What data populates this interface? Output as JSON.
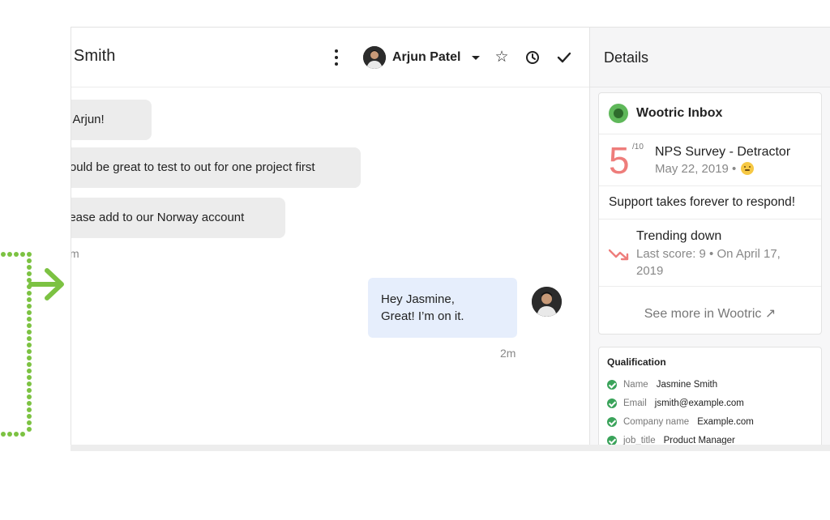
{
  "conversation": {
    "contact_name": "e Smith",
    "assignee": {
      "name": "Arjun Patel"
    },
    "icons": {
      "more": "more-vertical-icon",
      "star": "star-icon",
      "snooze": "clock-icon",
      "close": "check-icon"
    },
    "incoming_messages": [
      {
        "text": "Hi Arjun!"
      },
      {
        "text": "Would be great to test to out for one project first"
      },
      {
        "text": "Please add to our Norway account"
      }
    ],
    "incoming_time": "m",
    "outgoing_message": {
      "line1": "Hey Jasmine,",
      "line2": "Great! I’m on it.",
      "time": "2m"
    }
  },
  "details": {
    "title": "Details",
    "wootric": {
      "title": "Wootric Inbox",
      "score": "5",
      "score_max": "/10",
      "survey_name": "NPS Survey - Detractor",
      "survey_date": "May 22, 2019 •",
      "comment": "Support takes forever to respond!",
      "trend_title": "Trending down",
      "trend_detail": "Last score: 9 • On April 17, 2019",
      "see_more": "See more in Wootric ↗"
    },
    "qualification": {
      "title": "Qualification",
      "fields": [
        {
          "key": "Name",
          "value": "Jasmine Smith"
        },
        {
          "key": "Email",
          "value": "jsmith@example.com"
        },
        {
          "key": "Company name",
          "value": "Example.com"
        },
        {
          "key": "job_title",
          "value": "Product Manager"
        }
      ]
    }
  },
  "colors": {
    "accent_green": "#7cc242",
    "score_red": "#ee7d7b",
    "outgoing_bubble": "#e6eefc",
    "incoming_bubble": "#ececec"
  }
}
